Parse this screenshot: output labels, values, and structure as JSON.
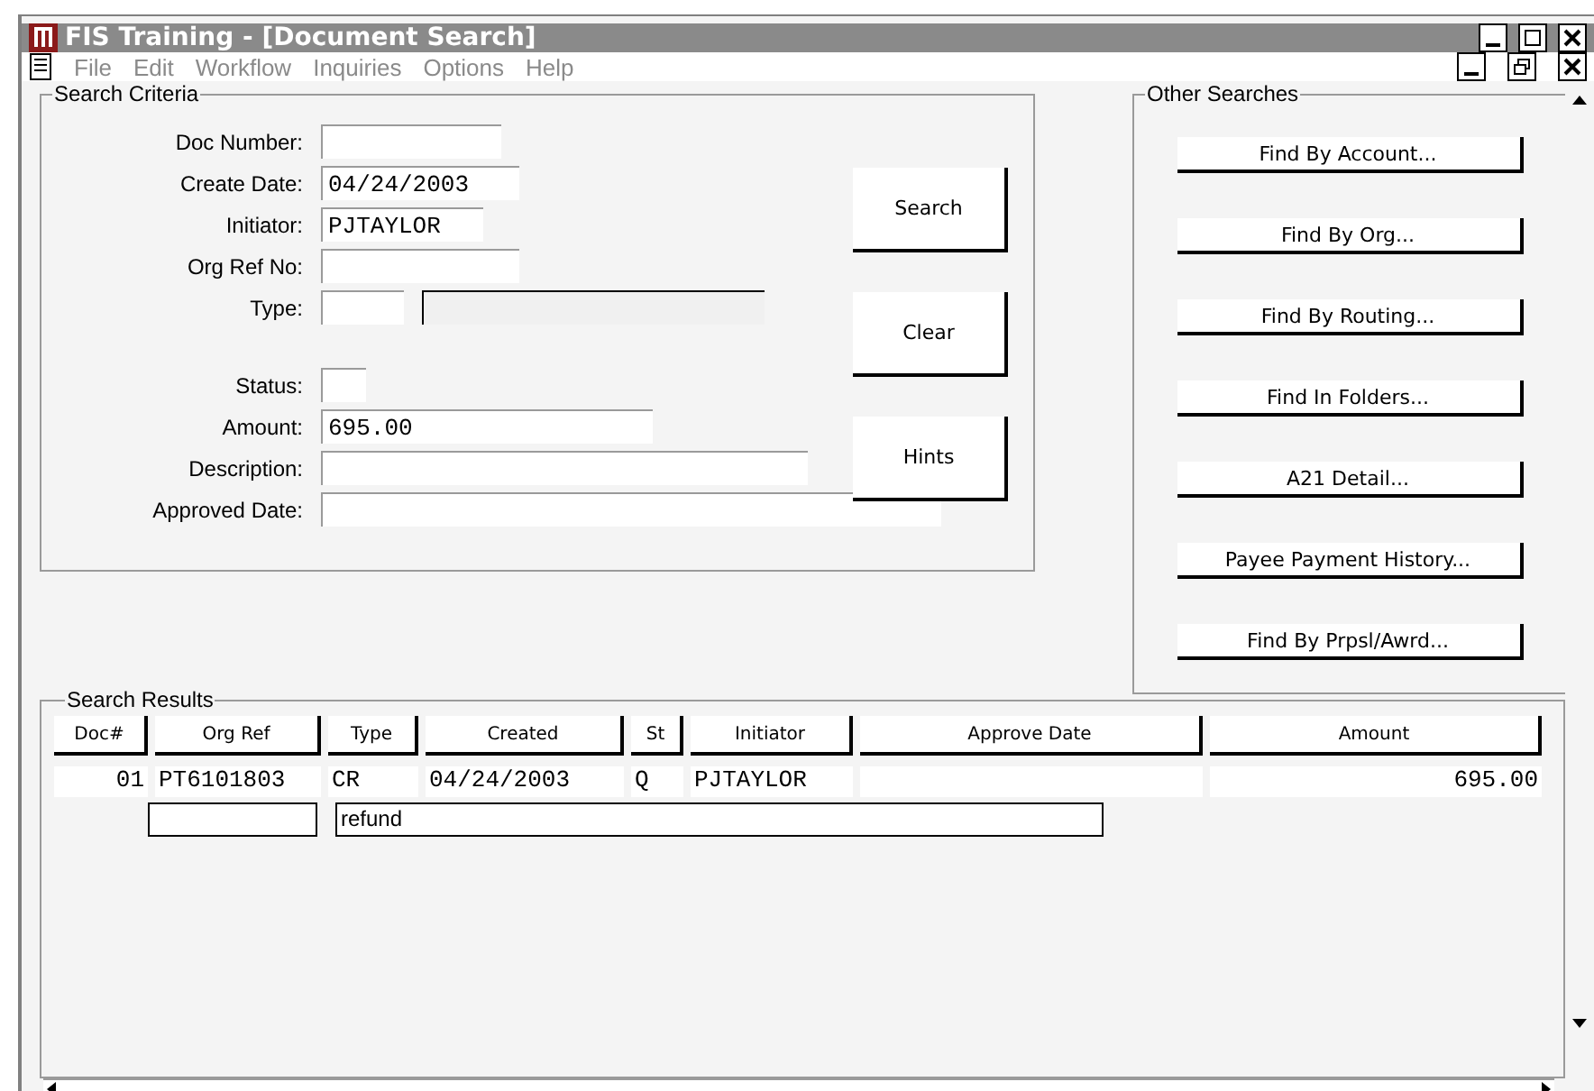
{
  "window": {
    "title": "FIS Training - [Document Search]"
  },
  "menu": [
    {
      "label": "File",
      "disabled": true
    },
    {
      "label": "Edit",
      "disabled": true
    },
    {
      "label": "Workflow",
      "disabled": true
    },
    {
      "label": "Inquiries",
      "disabled": true
    },
    {
      "label": "Options",
      "disabled": true
    },
    {
      "label": "Help",
      "disabled": true
    }
  ],
  "search_criteria": {
    "title": "Search Criteria",
    "fields": [
      {
        "label": "Doc Number:",
        "kind": "text"
      },
      {
        "label": "Create Date:",
        "kind": "text",
        "value": "04/24/2003"
      },
      {
        "label": "Initiator:",
        "kind": "text",
        "value": "PJTAYLOR"
      },
      {
        "label": "Org Ref No:",
        "kind": "text"
      },
      {
        "label": "Type:",
        "kind": "pair"
      },
      {
        "label": "Status:",
        "kind": "text"
      },
      {
        "label": "Amount:",
        "kind": "text",
        "value": "695.00"
      },
      {
        "label": "Description:",
        "kind": "text"
      },
      {
        "label": "Approved Date:",
        "kind": "text"
      }
    ],
    "buttons": [
      "Search",
      "Clear",
      "Hints"
    ]
  },
  "other_searches": {
    "title": "Other Searches",
    "buttons": [
      "Find By Account...",
      "Find By Org...",
      "Find By Routing...",
      "Find In Folders...",
      "A21 Detail...",
      "Payee Payment History...",
      "Find By Prpsl/Awrd..."
    ]
  },
  "search_results": {
    "title": "Search Results",
    "columns": [
      "Doc#",
      "Org Ref",
      "Type",
      "Created",
      "St",
      "Initiator",
      "Approve Date",
      "Amount"
    ],
    "rows": [
      {
        "doc": "01",
        "org_ref": "PT6101803",
        "type": "CR",
        "created": "04/24/2003",
        "st": "Q",
        "initiator": "PJTAYLOR",
        "amount": "695.00",
        "description": "refund"
      }
    ]
  }
}
